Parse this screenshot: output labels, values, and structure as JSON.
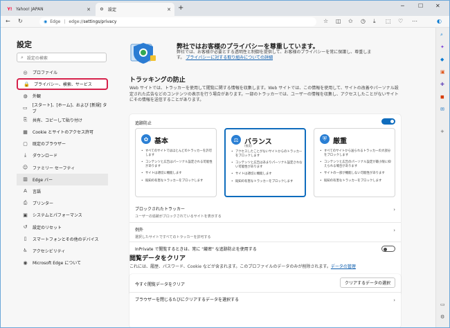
{
  "browser": {
    "tabs": [
      {
        "label": "Yahoo! JAPAN",
        "active": false
      },
      {
        "label": "設定",
        "active": true
      }
    ],
    "address": {
      "prefix": "Edge",
      "url_scheme": "edge://",
      "url_path": "settings/privacy"
    }
  },
  "sidebar": {
    "title": "設定",
    "search_placeholder": "設定の検索",
    "items": [
      {
        "label": "プロファイル",
        "icon": "person-icon"
      },
      {
        "label": "プライバシー、検索、サービス",
        "icon": "lock-icon",
        "selected": true
      },
      {
        "label": "外観",
        "icon": "appearance-icon"
      },
      {
        "label": "[スタート]、[ホーム]、および [新規] タブ",
        "icon": "home-icon"
      },
      {
        "label": "共有、コピーして貼り付け",
        "icon": "share-icon"
      },
      {
        "label": "Cookie とサイトのアクセス許可",
        "icon": "cookie-icon"
      },
      {
        "label": "既定のブラウザー",
        "icon": "browser-icon"
      },
      {
        "label": "ダウンロード",
        "icon": "download-icon"
      },
      {
        "label": "ファミリー セーフティ",
        "icon": "family-icon"
      },
      {
        "label": "Edge バー",
        "icon": "edge-bar-icon",
        "hover": true
      },
      {
        "label": "言語",
        "icon": "language-icon"
      },
      {
        "label": "プリンター",
        "icon": "printer-icon"
      },
      {
        "label": "システムとパフォーマンス",
        "icon": "system-icon"
      },
      {
        "label": "設定のリセット",
        "icon": "reset-icon"
      },
      {
        "label": "スマートフォンとその他のデバイス",
        "icon": "phone-icon"
      },
      {
        "label": "アクセシビリティ",
        "icon": "accessibility-icon"
      },
      {
        "label": "Microsoft Edge について",
        "icon": "edge-icon"
      }
    ]
  },
  "hero": {
    "title": "弊社ではお客様のプライバシーを尊重しています。",
    "desc": "弊社では、お客様が必要とする透明性と制御を提供して、お客様のプライバシーを常に保護し、尊重します。",
    "link": "プライバシーに対する取り組みについての詳細"
  },
  "tracking": {
    "heading": "トラッキングの防止",
    "desc": "Web サイトでは、トラッカーを使用して閲覧に関する情報を収集します。Web サイトでは、この情報を使用して、サイトの改善やパーソナル設定された広告などのコンテンツの表示を行う場合があります。一部のトラッカーでは、ユーザーの情報を収集し、アクセスしたことがないサイトにその情報を送信することがあります。",
    "label": "追跡防止",
    "enabled": true,
    "options": [
      {
        "title": "基本",
        "subtitle": "",
        "selected": false,
        "bullets": [
          "すべてのサイトではほとんどのトラッカーを許可します",
          "コンテンツと広告はパーソナル設定される可能性があります",
          "サイトは適切に機能します",
          "既知の有害なトラッカーをブロックします"
        ]
      },
      {
        "title": "バランス",
        "subtitle": "(推奨)",
        "selected": true,
        "bullets": [
          "アクセスしたことがないサイトからのトラッカーをブロックします",
          "コンテンツと広告はあまりパーソナル設定されない可能性があります",
          "サイトは適切に機能します",
          "既知の有害なトラッカーをブロックします"
        ]
      },
      {
        "title": "厳重",
        "subtitle": "",
        "selected": false,
        "bullets": [
          "すべてのサイトから送られるトラッカーの大部分をブロックします",
          "コンテンツと広告のパーソナル設定が最小限に抑えられる場合があります",
          "サイトの一部が機能しない可能性があります",
          "既知の有害なトラッカーをブロックします"
        ]
      }
    ],
    "blocked_title": "ブロックされたトラッカー",
    "blocked_sub": "ユーザーの追跡がブロックされているサイトを表示する",
    "exceptions_title": "例外",
    "exceptions_sub": "選択したサイトですべてのトラッカーを許可する",
    "inprivate": "InPrivate で閲覧するときは、常に \"厳密\" な追跡防止を使用する"
  },
  "clear": {
    "heading": "閲覧データをクリア",
    "desc": "これには、履歴、パスワード、Cookie などが含まれます。このプロファイルのデータのみが削除されます。",
    "desc_link": "データの管理",
    "now_label": "今すぐ閲覧データをクリア",
    "button": "クリアするデータの選択",
    "on_close": "ブラウザーを閉じるたびにクリアするデータを選択する"
  }
}
